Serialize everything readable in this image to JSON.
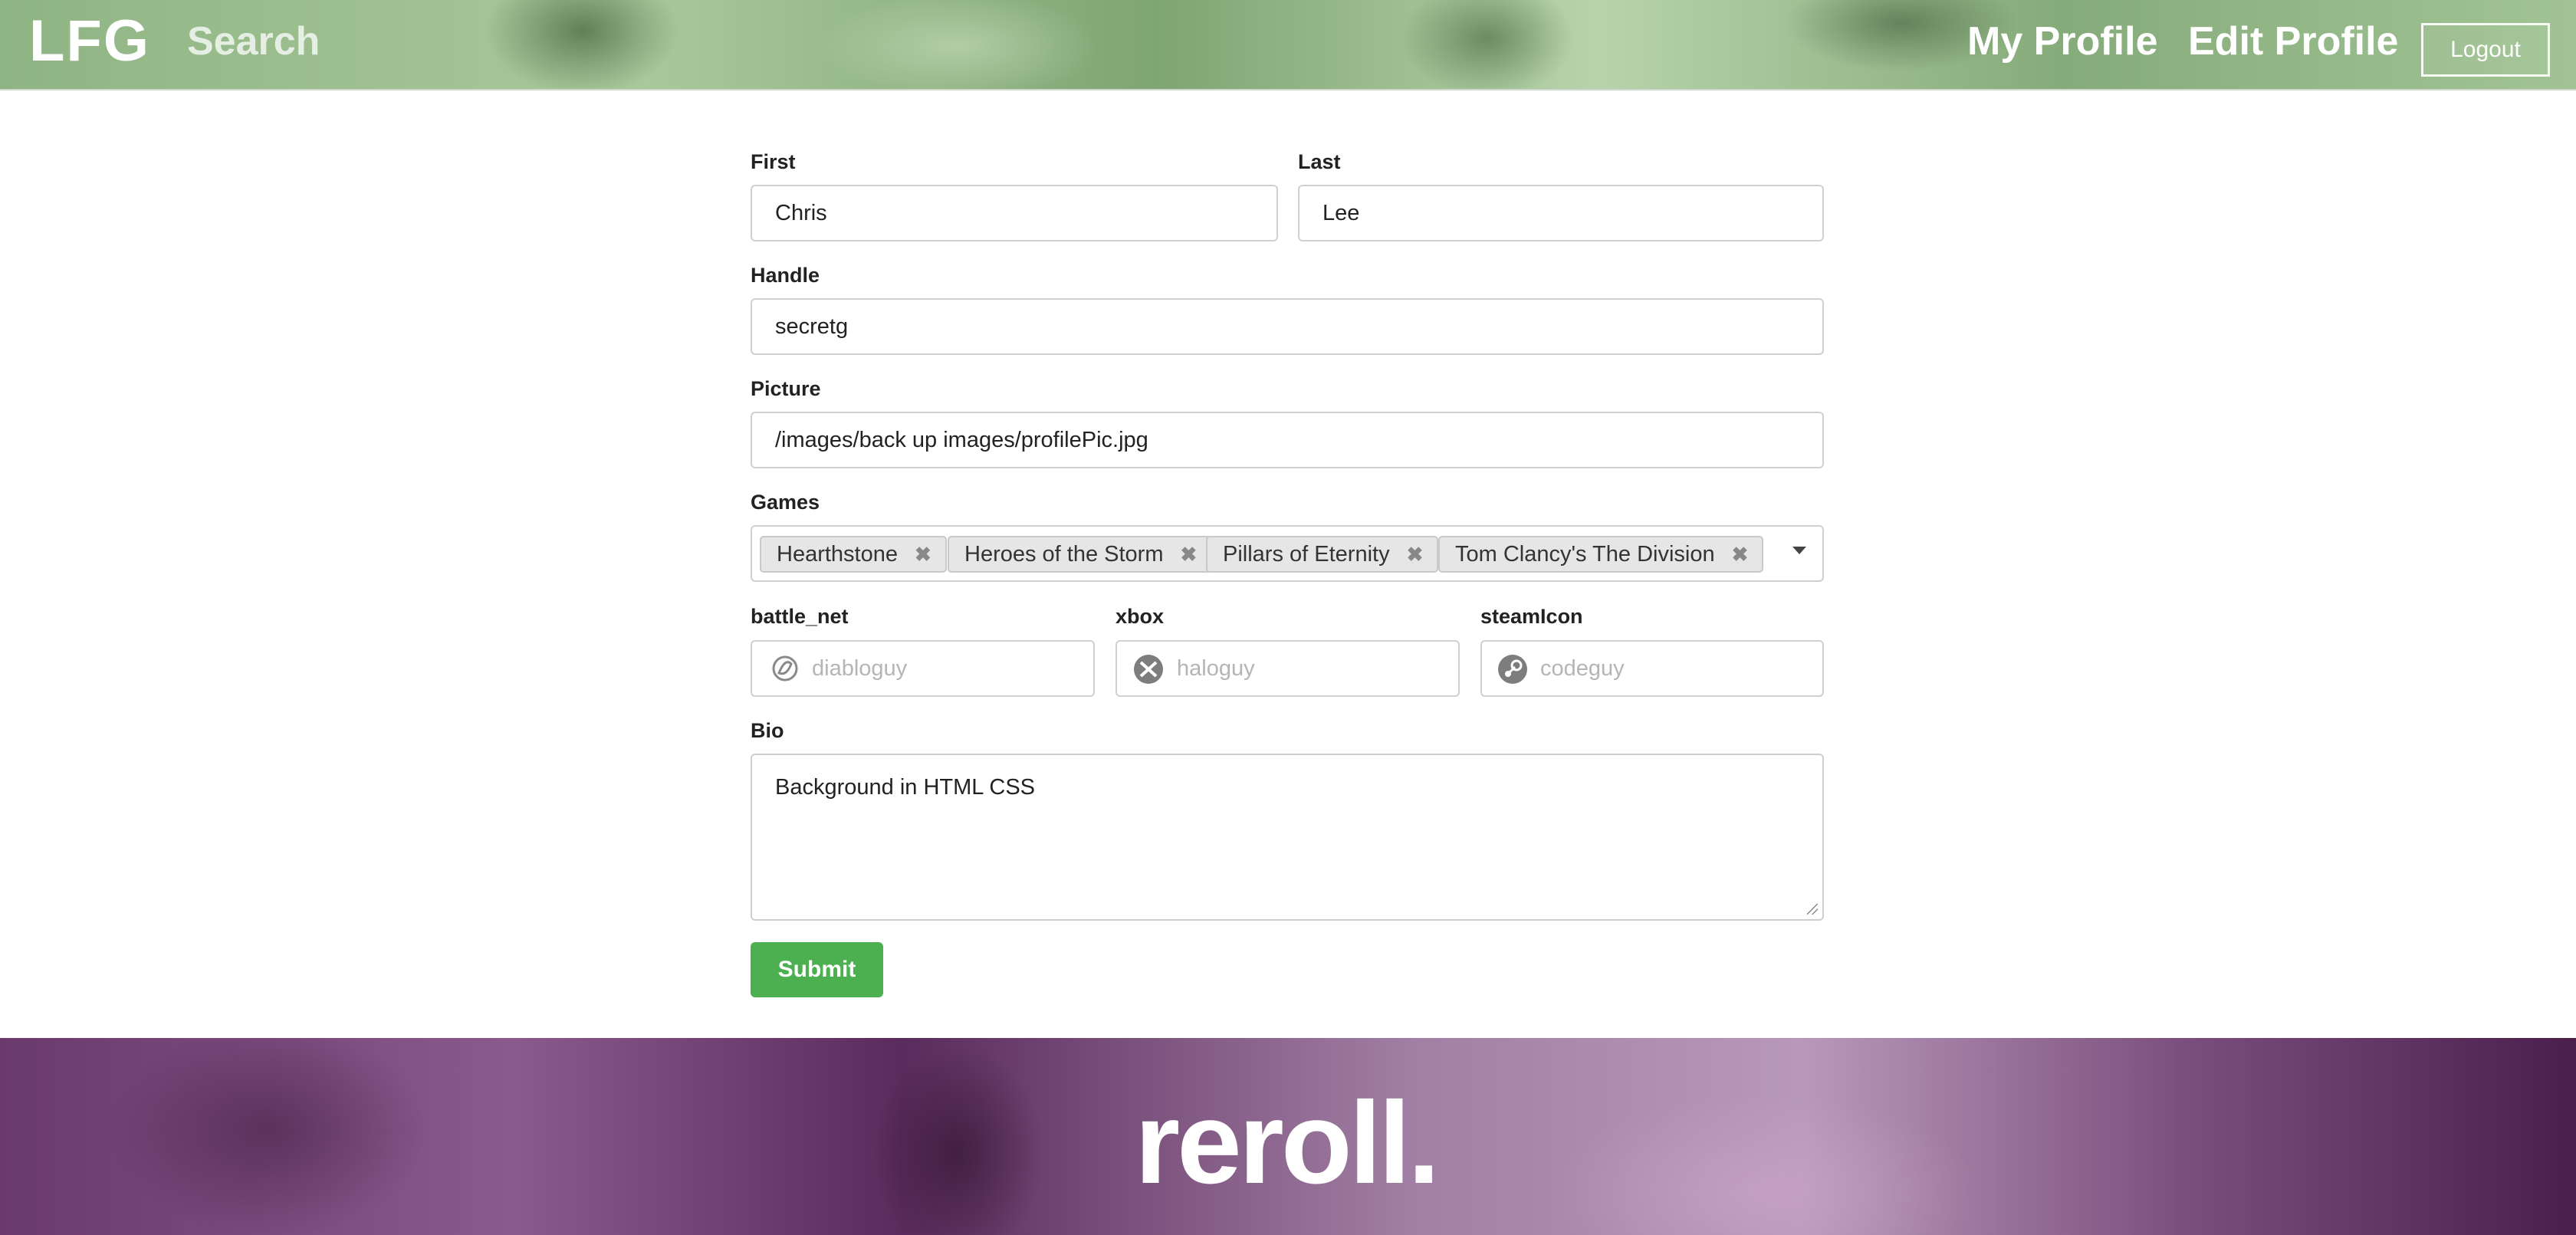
{
  "header": {
    "brand": "LFG",
    "nav": {
      "search": "Search",
      "my_profile": "My Profile",
      "edit_profile": "Edit Profile"
    },
    "logout_label": "Logout"
  },
  "form": {
    "first": {
      "label": "First",
      "value": "Chris"
    },
    "last": {
      "label": "Last",
      "value": "Lee"
    },
    "handle": {
      "label": "Handle",
      "value": "secretg"
    },
    "picture": {
      "label": "Picture",
      "value": "/images/back up images/profilePic.jpg"
    },
    "games": {
      "label": "Games",
      "selected": [
        "Hearthstone",
        "Heroes of the Storm",
        "Pillars of Eternity",
        "Tom Clancy's The Division"
      ],
      "remove_glyph": "✖"
    },
    "battle_net": {
      "label": "battle_net",
      "placeholder": "diabloguy",
      "icon": "battle-net-icon"
    },
    "xbox": {
      "label": "xbox",
      "placeholder": "haloguy",
      "icon": "xbox-icon"
    },
    "steam": {
      "label": "steamIcon",
      "placeholder": "codeguy",
      "icon": "steam-icon"
    },
    "bio": {
      "label": "Bio",
      "value": "Background in HTML CSS"
    },
    "submit_label": "Submit"
  },
  "footer": {
    "logo": "reroll."
  },
  "colors": {
    "submit": "#4cb050",
    "header_tint": "#9fc392",
    "footer_tint": "#7a4e7c"
  }
}
